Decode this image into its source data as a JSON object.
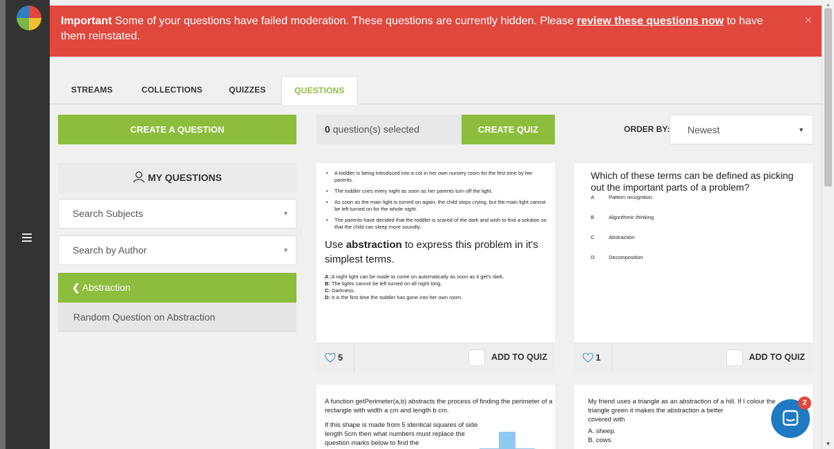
{
  "alert": {
    "prefix": "Important",
    "text_before": " Some of your questions have failed moderation. These questions are currently hidden. Please ",
    "link": "review these questions now",
    "text_after": " to have them reinstated.",
    "close": "×",
    "color": "#e0483e"
  },
  "tabs": [
    {
      "label": "STREAMS"
    },
    {
      "label": "COLLECTIONS"
    },
    {
      "label": "QUIZZES"
    },
    {
      "label": "QUESTIONS",
      "active": true
    }
  ],
  "sidebar_left": {
    "create_question": "CREATE A QUESTION",
    "my_questions": "MY QUESTIONS",
    "search_subjects": "Search Subjects",
    "search_author": "Search by Author",
    "active_subject": "Abstraction",
    "subject_item": "Random Question on Abstraction"
  },
  "selection": {
    "count": "0",
    "label": " question(s) selected",
    "create_quiz": "CREATE QUIZ"
  },
  "order": {
    "label": "ORDER BY:",
    "value": "Newest"
  },
  "cards": {
    "card1": {
      "bullets": [
        "A toddler is being introduced into a cot in her own nursery room for the first time by her parents.",
        "The toddler cries every night as soon as her parents turn off the light.",
        "As soon as the main light is turned on again, the child stops crying, but the main light cannot be left turned on for the whole night.",
        "The parents have decided that the toddler is scared of the dark and wish to find a solution so that the child can sleep more soundly."
      ],
      "question_pre": "Use ",
      "question_bold": "abstraction",
      "question_post": " to express this problem in it's simplest terms.",
      "answers": [
        {
          "letter": "A :",
          "text": "A night light can be made to come on automatically as soon as it get's dark."
        },
        {
          "letter": "B:",
          "text": " The lights cannot be left turned on all night long."
        },
        {
          "letter": "C:",
          "text": " Darkness."
        },
        {
          "letter": "D:",
          "text": " It is the first time the toddler has gone into her own room."
        }
      ],
      "likes": "5",
      "add_to_quiz": "ADD TO QUIZ"
    },
    "card2": {
      "question": "Which of these terms can be defined as picking out the important parts of a problem?",
      "options": [
        {
          "letter": "A",
          "text": "Pattern recognition"
        },
        {
          "letter": "B",
          "text": "Algorithmic thinking"
        },
        {
          "letter": "C",
          "text": "Abstraction"
        },
        {
          "letter": "D",
          "text": "Decomposition"
        }
      ],
      "likes": "1",
      "add_to_quiz": "ADD TO QUIZ"
    },
    "card3": {
      "p1": "A function getPerimeter(a,b) abstracts the process of finding the perimeter of a rectangle with width a cm and length b cm.",
      "p2": "If this shape is made from 5 identical squares of side length 5cm then what numbers must replace the question marks below to find the"
    },
    "card4": {
      "p1": "My friend uses a triangle as an abstraction of a hill. If I colour the triangle green it makes the abstraction a better",
      "p1b": "covered with",
      "opt_a": "A. sheep.",
      "opt_b": "B. cows."
    }
  },
  "chat": {
    "badge": "2"
  },
  "icons": {
    "menu": "hamburger-icon",
    "logo": "app-logo",
    "user": "user-icon",
    "heart": "heart-icon",
    "chevron": "chevron-left-icon",
    "chat": "chat-icon"
  },
  "colors": {
    "green": "#8dbd3d",
    "red": "#e0483e",
    "sidebar": "#333333",
    "chat_blue": "#1f7ac3"
  }
}
